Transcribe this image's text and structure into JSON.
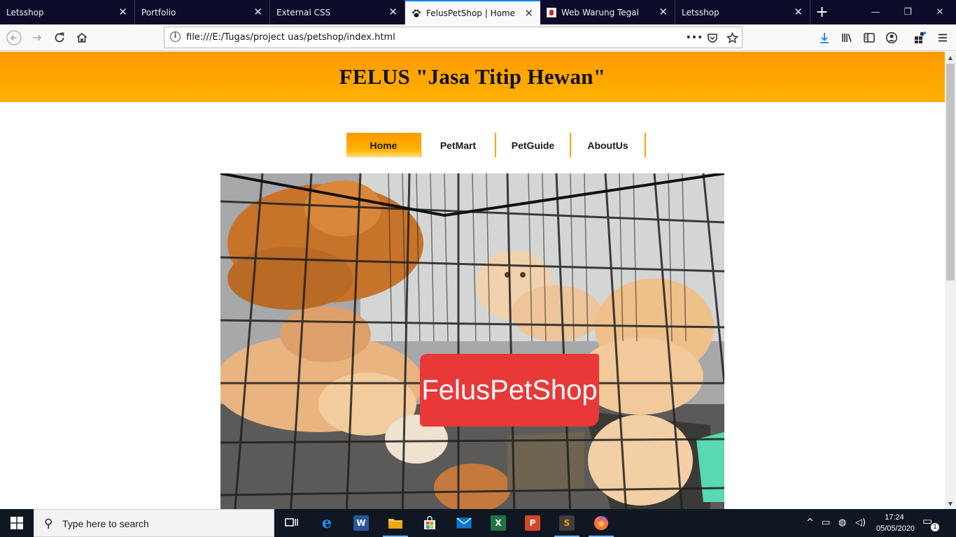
{
  "browser": {
    "tabs": [
      {
        "title": "Letsshop",
        "favicon": "none",
        "active": false
      },
      {
        "title": "Portfolio",
        "favicon": "none",
        "active": false
      },
      {
        "title": "External CSS",
        "favicon": "none",
        "active": false
      },
      {
        "title": "FelusPetShop | Home",
        "favicon": "paw-icon",
        "active": true
      },
      {
        "title": "Web Warung Tegal",
        "favicon": "red-page-icon",
        "active": false
      },
      {
        "title": "Letsshop",
        "favicon": "none",
        "active": false
      }
    ],
    "url": "file:///E:/Tugas/project uas/petshop/index.html",
    "accent_color": "#0a84ff"
  },
  "page": {
    "header_title": "FELUS \"Jasa Titip Hewan\"",
    "header_gradient": [
      "#ff9a00",
      "#ffb100"
    ],
    "menu": [
      {
        "label": "Home",
        "active": true
      },
      {
        "label": "PetMart",
        "active": false
      },
      {
        "label": "PetGuide",
        "active": false
      },
      {
        "label": "AboutUs",
        "active": false
      }
    ],
    "hero_image_text": "FelusPetShop",
    "hero_image_subject": "kittens in a wire cage"
  },
  "taskbar": {
    "search_placeholder": "Type here to search",
    "apps": [
      "task-view-icon",
      "edge-icon",
      "word-icon",
      "file-explorer-icon",
      "store-icon",
      "mail-icon",
      "excel-icon",
      "powerpoint-icon",
      "sublime-text-icon",
      "firefox-icon"
    ],
    "time": "17:24",
    "date": "05/05/2020",
    "notification_count": "1"
  }
}
